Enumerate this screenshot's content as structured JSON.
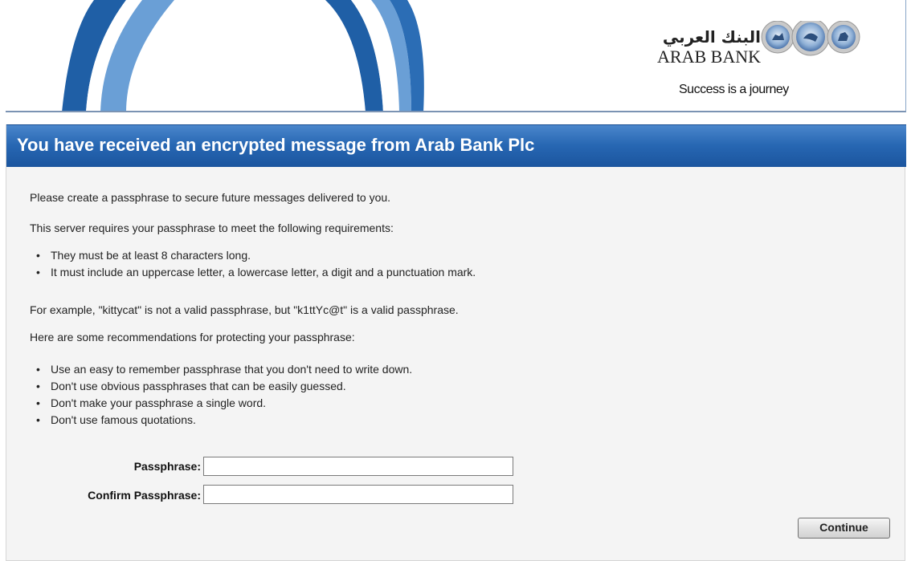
{
  "header": {
    "logo_arabic": "البنك العربي",
    "logo_english": "ARAB BANK",
    "tagline": "Success is a journey"
  },
  "title": "You have received an encrypted message from Arab Bank Plc",
  "intro": "Please create a passphrase to secure future messages delivered to you.",
  "requirements_intro": "This server requires your passphrase to meet the following requirements:",
  "requirements": [
    "They must be at least 8 characters long.",
    "It must include an uppercase letter, a lowercase letter, a digit and a punctuation mark."
  ],
  "example": "For example, \"kittycat\" is not a valid passphrase, but \"k1ttYc@t\" is a valid passphrase.",
  "recommendations_intro": "Here are some recommendations for protecting your passphrase:",
  "recommendations": [
    "Use an easy to remember passphrase that you don't need to write down.",
    "Don't use obvious passphrases that can be easily guessed.",
    "Don't make your passphrase a single word.",
    "Don't use famous quotations."
  ],
  "form": {
    "passphrase_label": "Passphrase:",
    "passphrase_value": "",
    "confirm_label": "Confirm Passphrase:",
    "confirm_value": "",
    "continue_label": "Continue"
  },
  "colors": {
    "title_bar": "#2767b3",
    "arc_dark": "#1f5fa6",
    "arc_light": "#6a9fd6"
  }
}
